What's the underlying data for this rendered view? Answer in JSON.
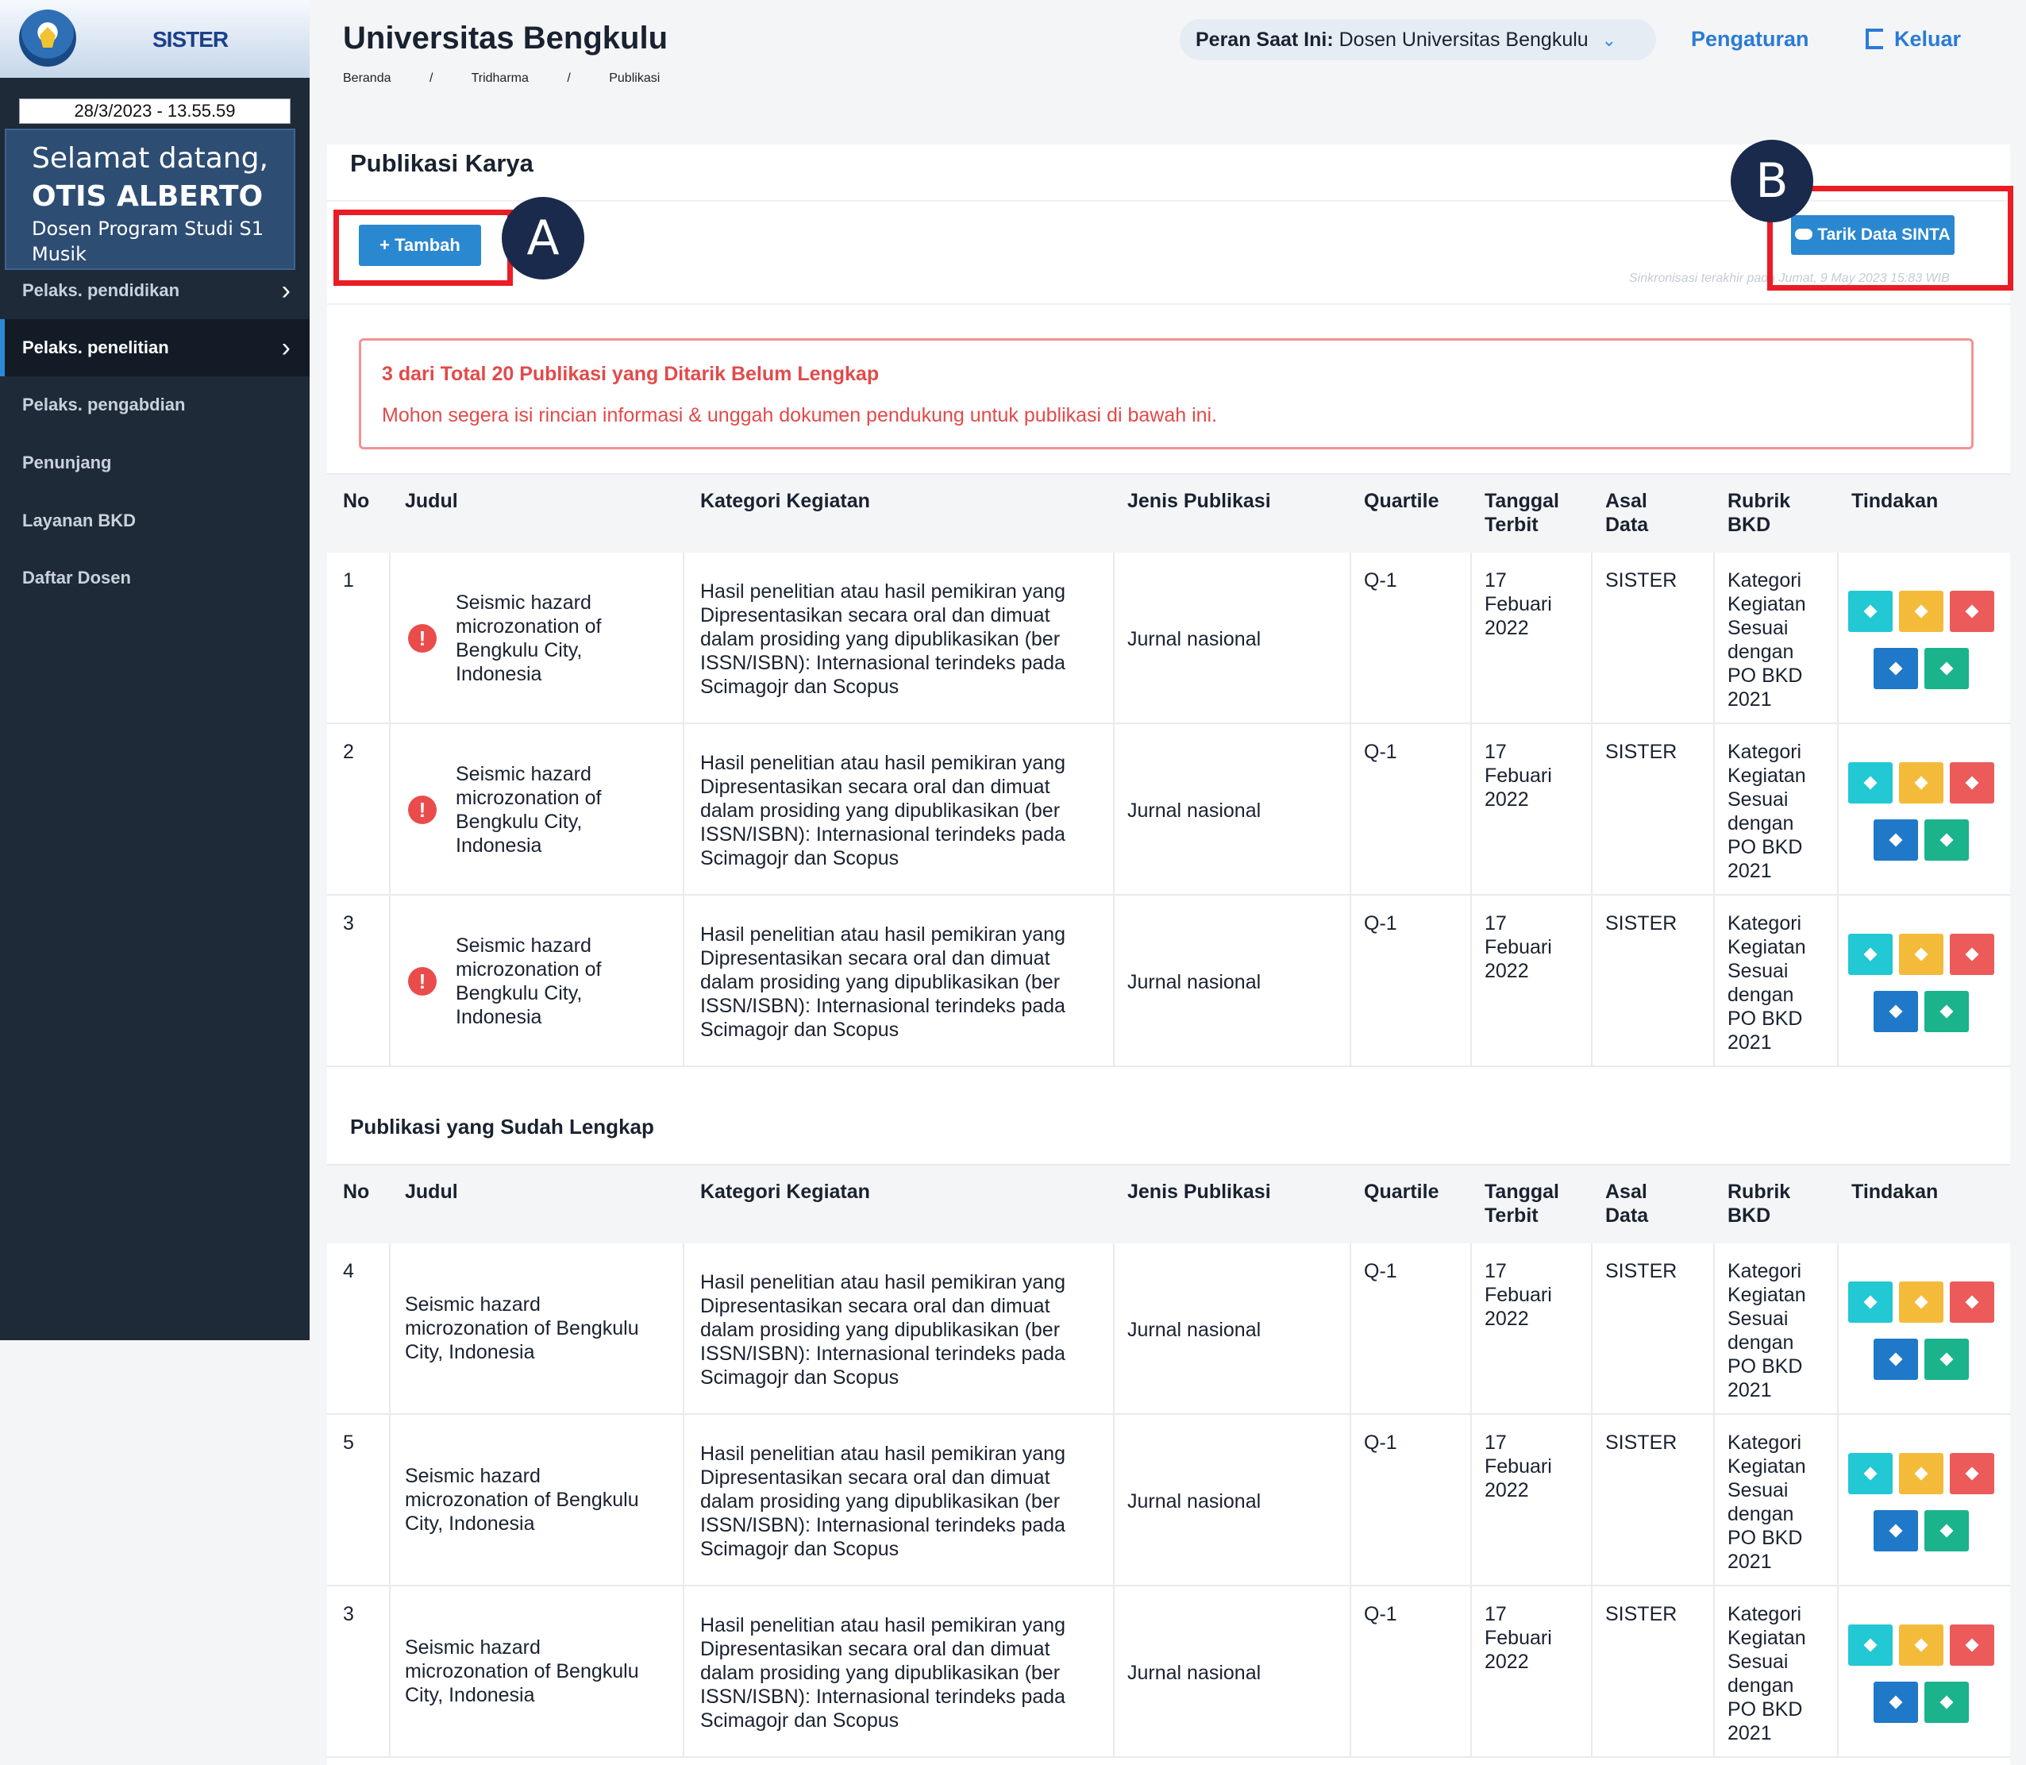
{
  "sidebar": {
    "brand": "SISTER",
    "datetime": "28/3/2023 - 13.55.59",
    "welcome": {
      "greeting": "Selamat datang,",
      "name": "OTIS ALBERTO",
      "role": "Dosen Program Studi S1 Musik"
    },
    "items": [
      {
        "label": "Pelaks. pendidikan",
        "has_chevron": true
      },
      {
        "label": "Pelaks. penelitian",
        "has_chevron": true,
        "active": true
      },
      {
        "label": "Pelaks. pengabdian"
      },
      {
        "label": "Penunjang"
      },
      {
        "label": "Layanan BKD"
      },
      {
        "label": "Daftar Dosen"
      }
    ]
  },
  "header": {
    "title": "Universitas Bengkulu",
    "breadcrumb": [
      "Beranda",
      "/",
      "Tridharma",
      "/",
      "Publikasi"
    ],
    "role_label": "Peran Saat Ini:",
    "role_value": "Dosen Universitas Bengkulu",
    "settings": "Pengaturan",
    "logout": "Keluar"
  },
  "page": {
    "title": "Publikasi Karya",
    "add_button": "Tambah",
    "sinta_button": "Tarik Data SINTA",
    "sync_note": "Sinkronisasi terakhir pada Jumat, 9 May 2023 15:83 WIB",
    "markers": {
      "a": "A",
      "b": "B"
    }
  },
  "alert": {
    "title": "3 dari Total 20 Publikasi yang Ditarik Belum Lengkap",
    "message": "Mohon segera isi rincian informasi & unggah dokumen pendukung untuk publikasi di bawah ini."
  },
  "columns": {
    "no": "No",
    "judul": "Judul",
    "kategori": "Kategori Kegiatan",
    "jenis": "Jenis Publikasi",
    "quartile": "Quartile",
    "tanggal_1": "Tanggal",
    "tanggal_2": "Terbit",
    "asal_1": "Asal",
    "asal_2": "Data",
    "rubrik_1": "Rubrik",
    "rubrik_2": "BKD",
    "tindakan": "Tindakan"
  },
  "incomplete_rows": [
    {
      "no": "1",
      "judul": [
        "Seismic hazard",
        "microzonation of",
        "Bengkulu City,",
        "Indonesia"
      ],
      "kategori": [
        "Hasil penelitian atau hasil pemikiran yang",
        "Dipresentasikan secara oral dan dimuat",
        "dalam prosiding yang dipublikasikan (ber",
        "ISSN/ISBN): Internasional terindeks pada",
        "Scimagojr dan Scopus"
      ],
      "jenis": "Jurnal nasional",
      "quartile": "Q-1",
      "tanggal": [
        "17",
        "Febuari",
        "2022"
      ],
      "asal": "SISTER",
      "rubrik": [
        "Kategori",
        "Kegiatan",
        "Sesuai",
        "dengan",
        "PO BKD",
        "2021"
      ]
    },
    {
      "no": "2",
      "judul": [
        "Seismic hazard",
        "microzonation of",
        "Bengkulu City,",
        "Indonesia"
      ],
      "kategori": [
        "Hasil penelitian atau hasil pemikiran yang",
        "Dipresentasikan secara oral dan dimuat",
        "dalam prosiding yang dipublikasikan (ber",
        "ISSN/ISBN): Internasional terindeks pada",
        "Scimagojr dan Scopus"
      ],
      "jenis": "Jurnal nasional",
      "quartile": "Q-1",
      "tanggal": [
        "17",
        "Febuari",
        "2022"
      ],
      "asal": "SISTER",
      "rubrik": [
        "Kategori",
        "Kegiatan",
        "Sesuai",
        "dengan",
        "PO BKD",
        "2021"
      ]
    },
    {
      "no": "3",
      "judul": [
        "Seismic hazard",
        "microzonation of",
        "Bengkulu City,",
        "Indonesia"
      ],
      "kategori": [
        "Hasil penelitian atau hasil pemikiran yang",
        "Dipresentasikan secara oral dan dimuat",
        "dalam prosiding yang dipublikasikan (ber",
        "ISSN/ISBN): Internasional terindeks pada",
        "Scimagojr dan Scopus"
      ],
      "jenis": "Jurnal nasional",
      "quartile": "Q-1",
      "tanggal": [
        "17",
        "Febuari",
        "2022"
      ],
      "asal": "SISTER",
      "rubrik": [
        "Kategori",
        "Kegiatan",
        "Sesuai",
        "dengan",
        "PO BKD",
        "2021"
      ]
    }
  ],
  "complete_section_title": "Publikasi yang Sudah Lengkap",
  "complete_rows": [
    {
      "no": "4",
      "judul": [
        "Seismic hazard",
        "microzonation of Bengkulu",
        "City, Indonesia"
      ],
      "kategori": [
        "Hasil penelitian atau hasil pemikiran yang",
        "Dipresentasikan secara oral dan dimuat",
        "dalam prosiding yang dipublikasikan (ber",
        "ISSN/ISBN): Internasional terindeks pada",
        "Scimagojr dan Scopus"
      ],
      "jenis": "Jurnal nasional",
      "quartile": "Q-1",
      "tanggal": [
        "17",
        "Febuari",
        "2022"
      ],
      "asal": "SISTER",
      "rubrik": [
        "Kategori",
        "Kegiatan",
        "Sesuai",
        "dengan",
        "PO BKD",
        "2021"
      ]
    },
    {
      "no": "5",
      "judul": [
        "Seismic hazard",
        "microzonation of Bengkulu",
        "City, Indonesia"
      ],
      "kategori": [
        "Hasil penelitian atau hasil pemikiran yang",
        "Dipresentasikan secara oral dan dimuat",
        "dalam prosiding yang dipublikasikan (ber",
        "ISSN/ISBN): Internasional terindeks pada",
        "Scimagojr dan Scopus"
      ],
      "jenis": "Jurnal nasional",
      "quartile": "Q-1",
      "tanggal": [
        "17",
        "Febuari",
        "2022"
      ],
      "asal": "SISTER",
      "rubrik": [
        "Kategori",
        "Kegiatan",
        "Sesuai",
        "dengan",
        "PO BKD",
        "2021"
      ]
    },
    {
      "no": "3",
      "judul": [
        "Seismic hazard",
        "microzonation of Bengkulu",
        "City, Indonesia"
      ],
      "kategori": [
        "Hasil penelitian atau hasil pemikiran yang",
        "Dipresentasikan secara oral dan dimuat",
        "dalam prosiding yang dipublikasikan (ber",
        "ISSN/ISBN): Internasional terindeks pada",
        "Scimagojr dan Scopus"
      ],
      "jenis": "Jurnal nasional",
      "quartile": "Q-1",
      "tanggal": [
        "17",
        "Febuari",
        "2022"
      ],
      "asal": "SISTER",
      "rubrik": [
        "Kategori",
        "Kegiatan",
        "Sesuai",
        "dengan",
        "PO BKD",
        "2021"
      ]
    }
  ],
  "action_buttons": [
    {
      "name": "view-button",
      "color": "#22c8d3"
    },
    {
      "name": "edit-button",
      "color": "#f4bb3b"
    },
    {
      "name": "delete-button",
      "color": "#ec5a5a"
    },
    {
      "name": "upload-button",
      "color": "#2078c9"
    },
    {
      "name": "verify-button",
      "color": "#1bb38c"
    }
  ],
  "colors": {
    "sidebar_bg": "#1f2a38",
    "accent": "#2a88d0",
    "alert": "#e24a4a",
    "marker_outline": "#ea1c24",
    "marker_circle": "#1a2a4c"
  }
}
